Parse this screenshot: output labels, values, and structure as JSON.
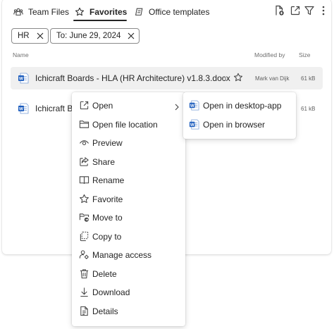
{
  "tabs": [
    {
      "label": "Team Files",
      "icon": "team-icon"
    },
    {
      "label": "Favorites",
      "icon": "star-icon",
      "active": true
    },
    {
      "label": "Office templates",
      "icon": "template-icon"
    }
  ],
  "toolbar_icons": [
    "new-document-icon",
    "open-external-icon",
    "filter-icon",
    "more-icon"
  ],
  "filters": [
    {
      "label": "HR"
    },
    {
      "label": "To: June 29, 2024"
    }
  ],
  "columns": {
    "name": "Name",
    "modified_by": "Modified by",
    "size": "Size"
  },
  "files": [
    {
      "name": "Ichicraft Boards - HLA (HR Architecture) v1.8.3.docx",
      "modified_by": "Mark van Dijk",
      "size": "61 kB",
      "more": "···"
    },
    {
      "name": "Ichicraft Boa",
      "size": "61 kB"
    }
  ],
  "context_menu": [
    {
      "label": "Open",
      "icon": "open-icon",
      "has_submenu": true
    },
    {
      "label": "Open file location",
      "icon": "folder-icon"
    },
    {
      "label": "Preview",
      "icon": "eye-icon"
    },
    {
      "label": "Share",
      "icon": "share-icon"
    },
    {
      "label": "Rename",
      "icon": "rename-icon"
    },
    {
      "label": "Favorite",
      "icon": "star-icon"
    },
    {
      "label": "Move to",
      "icon": "move-icon"
    },
    {
      "label": "Copy to",
      "icon": "copy-icon"
    },
    {
      "label": "Manage access",
      "icon": "manage-access-icon"
    },
    {
      "label": "Delete",
      "icon": "delete-icon"
    },
    {
      "label": "Download",
      "icon": "download-icon"
    },
    {
      "label": "Details",
      "icon": "details-icon"
    }
  ],
  "open_submenu": [
    {
      "label": "Open in desktop-app",
      "icon": "word-icon"
    },
    {
      "label": "Open in browser",
      "icon": "word-icon"
    }
  ],
  "colors": {
    "word_blue": "#185abd",
    "selected_row": "#f0f0f0",
    "text": "#242424"
  }
}
